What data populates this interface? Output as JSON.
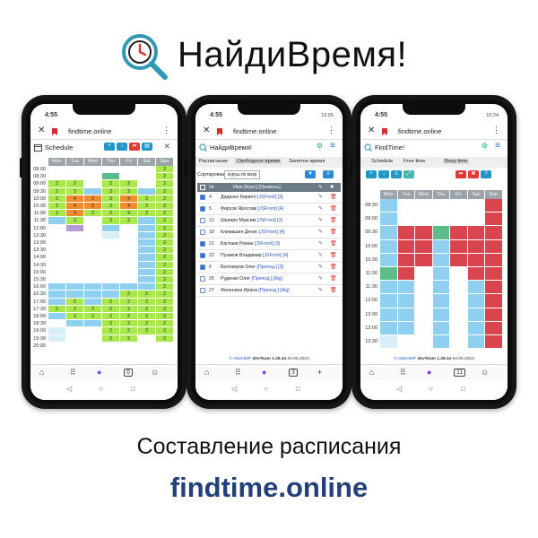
{
  "brand": {
    "title": "НайдиВремя!"
  },
  "caption": "Составление расписания",
  "site": "findtime.online",
  "phone1": {
    "time": "4:55",
    "url": "findtime.online",
    "title": "Schedule",
    "days": [
      "Mon",
      "Tue",
      "Wed",
      "Thu",
      "Fri",
      "Sat",
      "Sun"
    ],
    "times": [
      "08:00",
      "08:30",
      "09:00",
      "09:30",
      "10:00",
      "10:30",
      "11:00",
      "11:30",
      "12:00",
      "12:30",
      "13:00",
      "13:30",
      "14:00",
      "14:30",
      "15:00",
      "15:30",
      "16:00",
      "16:30",
      "17:00",
      "17:30",
      "18:00",
      "18:30",
      "19:00",
      "19:30",
      "20:00"
    ],
    "nav_badge": "6"
  },
  "phone2": {
    "time": "4:55",
    "sysinfo": "13:05",
    "url": "findtime.online",
    "title": "НайдиВремя!",
    "tabs": [
      "Расписание",
      "Свободное время",
      "Занятое время"
    ],
    "sort_label": "Сортировка",
    "sort_value": "курсы по возр",
    "headers": {
      "num": "№",
      "name": "Имя [Курс] [Уровень]"
    },
    "rows": [
      {
        "n": "4",
        "name": "Диденко Кирилл",
        "tag": "[JSFront] [3]",
        "checked": true
      },
      {
        "n": "5",
        "name": "Фирсов Ярослав",
        "tag": "[JSFront] [4]",
        "checked": true
      },
      {
        "n": "12",
        "name": "Шапиро Максим",
        "tag": "[JSFront] [3]",
        "checked": false
      },
      {
        "n": "18",
        "name": "Климашин Денис",
        "tag": "[JSFront] [4]",
        "checked": false
      },
      {
        "n": "21",
        "name": "Баглаев Роман",
        "tag": "[JSFront] [3]",
        "checked": true
      },
      {
        "n": "22",
        "name": "Пузиков Владимир",
        "tag": "[JSFront] [4]",
        "checked": true
      },
      {
        "n": "6",
        "name": "Белозеров Олег",
        "tag": "[Препод.] [3]",
        "checked": true
      },
      {
        "n": "26",
        "name": "Руденко Олег",
        "tag": "[Препод.] [Alg]",
        "checked": false
      },
      {
        "n": "27",
        "name": "Филенина Ирина",
        "tag": "[Препод.] [Alg]",
        "checked": false
      }
    ],
    "footer_left": "© IslamMIP",
    "footer_mid": "devTeam",
    "footer_ver": "1.28.3a",
    "footer_date": "04.05.2023",
    "nav_badge": "3"
  },
  "phone3": {
    "time": "4:55",
    "sysinfo": "10:24",
    "url": "findtime.online",
    "title": "FindTime!",
    "tabs": [
      "Schedule",
      "Free time",
      "Busy time"
    ],
    "days": [
      "Mon",
      "Tue",
      "Wed",
      "Thu",
      "Fri",
      "Sat",
      "Sun"
    ],
    "times": [
      "08:30",
      "09:00",
      "09:30",
      "10:00",
      "10:30",
      "11:00",
      "11:30",
      "12:00",
      "12:30",
      "13:00",
      "13:30"
    ],
    "footer_left": "© IslamMIP",
    "footer_mid": "devTeam",
    "footer_ver": "1.28.3a",
    "footer_date": "04.05.2023",
    "nav_badge": "11"
  },
  "colors": {
    "lime": "#a8e84a",
    "blue": "#8fd0f0",
    "orange": "#f28a2e",
    "green": "#5cbd8b",
    "red": "#d8454f",
    "teal": "#47b5a8",
    "purple": "#b79bd6",
    "pale": "#d8eef8"
  }
}
